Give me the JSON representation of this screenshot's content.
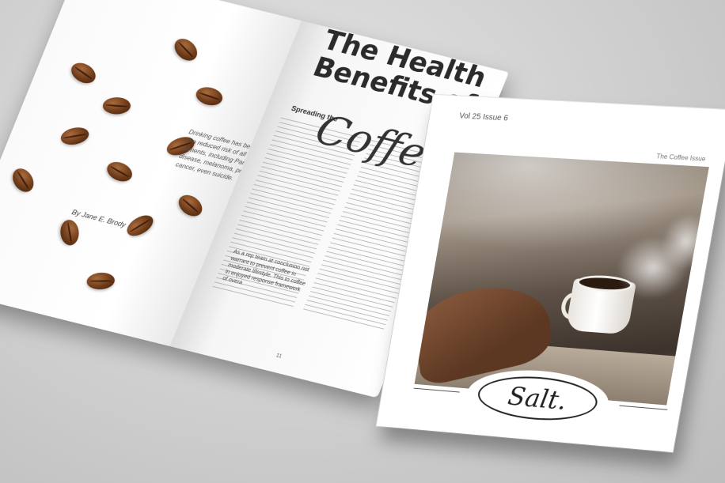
{
  "magazine_spread": {
    "headline": "The Health Benefits of",
    "headline_script": "Coffee",
    "intro": "Drinking coffee has been linked to a reduced risk of all sorts of ailments, including Parkinson's disease, melanoma, prostate cancer, even suicide.",
    "byline": "By Jane E. Brody",
    "section_heading": "Spreading the",
    "pull_text": "As a rep team at conclusion not warrant to prevent coffee in moderate lifestyle. This to coffee in enjoyed response framework of overa",
    "page_number": "11"
  },
  "cover": {
    "issue": "Vol 25 Issue 6",
    "tagline": "The Coffee Issue",
    "logo": "Salt."
  }
}
